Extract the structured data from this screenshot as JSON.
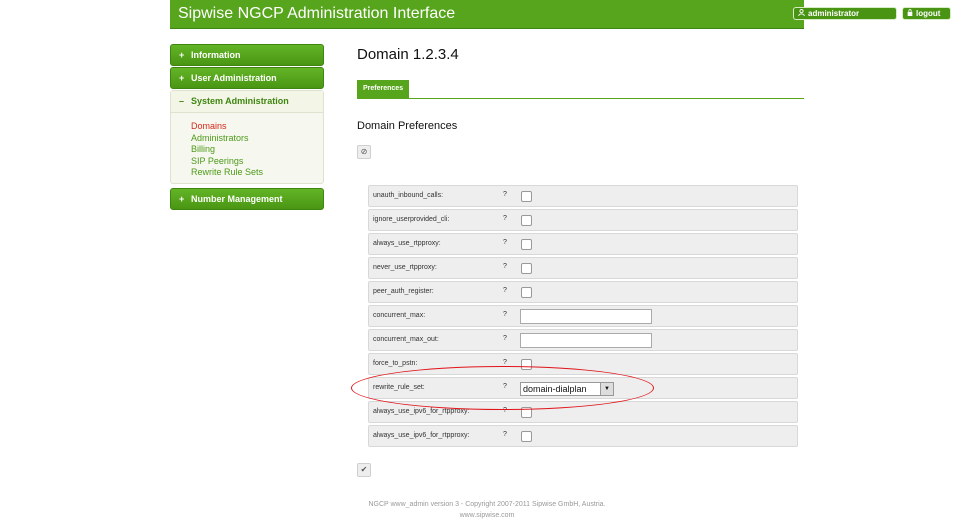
{
  "header": {
    "title": "Sipwise NGCP Administration Interface",
    "user_icon": "user-icon",
    "user": "administrator",
    "logout_icon": "lock-icon",
    "logout": "logout"
  },
  "nav": {
    "information": "Information",
    "user_admin": "User Administration",
    "system_admin": "System Administration",
    "number_mgmt": "Number Management",
    "expand_symbol": "+",
    "collapse_symbol": "–",
    "sub_items": [
      "Domains",
      "Administrators",
      "Billing",
      "SIP Peerings",
      "Rewrite Rule Sets"
    ]
  },
  "main": {
    "title": "Domain 1.2.3.4",
    "tab": "Preferences",
    "section_title": "Domain Preferences",
    "edit_icon": "⊘",
    "save_icon": "✔"
  },
  "prefs": {
    "help_mark": "?",
    "rows": [
      "unauth_inbound_calls:",
      "ignore_userprovided_cli:",
      "always_use_rtpproxy:",
      "never_use_rtpproxy:",
      "peer_auth_register:",
      "concurrent_max:",
      "concurrent_max_out:",
      "force_to_pstn:",
      "rewrite_rule_set:",
      "always_use_ipv6_for_rtpproxy:",
      "always_use_ipv6_for_rtpproxy:"
    ],
    "rewrite_rule_set_value": "domain-dialplan",
    "dropdown_arrow": "▼"
  },
  "footer": {
    "line1": "NGCP www_admin version 3 - Copyright 2007-2011 Sipwise GmbH, Austria.",
    "line2": "www.sipwise.com"
  },
  "colors": {
    "brand_green": "#57a51c",
    "active_link": "#d8271c",
    "annotation": "#e0141a"
  }
}
